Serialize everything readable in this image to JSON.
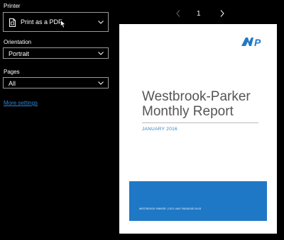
{
  "printer": {
    "label": "Printer",
    "value": "Print as a PDF",
    "icon": "pdf-printer-icon"
  },
  "orientation": {
    "label": "Orientation",
    "value": "Portrait"
  },
  "pages": {
    "label": "Pages",
    "value": "All"
  },
  "more_settings": "More settings",
  "pager": {
    "current": "1"
  },
  "preview": {
    "logo_text": "WP",
    "title_line1": "Westbrook-Parker",
    "title_line2": "Monthly Report",
    "date": "JANUARY 2016",
    "band_text": "WESTBROOK PARKER  |  1870 LAKE PARADISE BLVD",
    "accent": "#1f78c5"
  }
}
